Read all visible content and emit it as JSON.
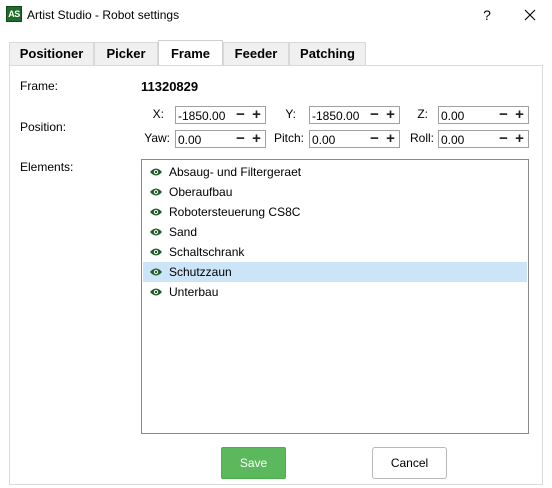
{
  "window": {
    "app_icon_text": "AS",
    "title": "Artist Studio - Robot settings",
    "help_label": "?",
    "close_icon": "close-icon"
  },
  "tabs": [
    {
      "label": "Positioner",
      "active": false
    },
    {
      "label": "Picker",
      "active": false
    },
    {
      "label": "Frame",
      "active": true
    },
    {
      "label": "Feeder",
      "active": false
    },
    {
      "label": "Patching",
      "active": false
    }
  ],
  "frame": {
    "label": "Frame:",
    "value": "11320829"
  },
  "position": {
    "label": "Position:",
    "x": {
      "label": "X:",
      "value": "-1850.00"
    },
    "y": {
      "label": "Y:",
      "value": "-1850.00"
    },
    "z": {
      "label": "Z:",
      "value": "0.00"
    },
    "yaw": {
      "label": "Yaw:",
      "value": "0.00"
    },
    "pitch": {
      "label": "Pitch:",
      "value": "0.00"
    },
    "roll": {
      "label": "Roll:",
      "value": "0.00"
    },
    "decrement_glyph": "−",
    "increment_glyph": "+"
  },
  "elements": {
    "label": "Elements:",
    "items": [
      {
        "label": "Absaug- und Filtergeraet",
        "visible": true,
        "selected": false
      },
      {
        "label": "Oberaufbau",
        "visible": true,
        "selected": false
      },
      {
        "label": "Robotersteuerung CS8C",
        "visible": true,
        "selected": false
      },
      {
        "label": "Sand",
        "visible": true,
        "selected": false
      },
      {
        "label": "Schaltschrank",
        "visible": true,
        "selected": false
      },
      {
        "label": "Schutzzaun",
        "visible": true,
        "selected": true
      },
      {
        "label": "Unterbau",
        "visible": true,
        "selected": false
      }
    ]
  },
  "buttons": {
    "save": "Save",
    "cancel": "Cancel"
  },
  "colors": {
    "save_bg": "#5cb85c",
    "selection": "#cce4f7",
    "eye": "#1e5a28"
  }
}
